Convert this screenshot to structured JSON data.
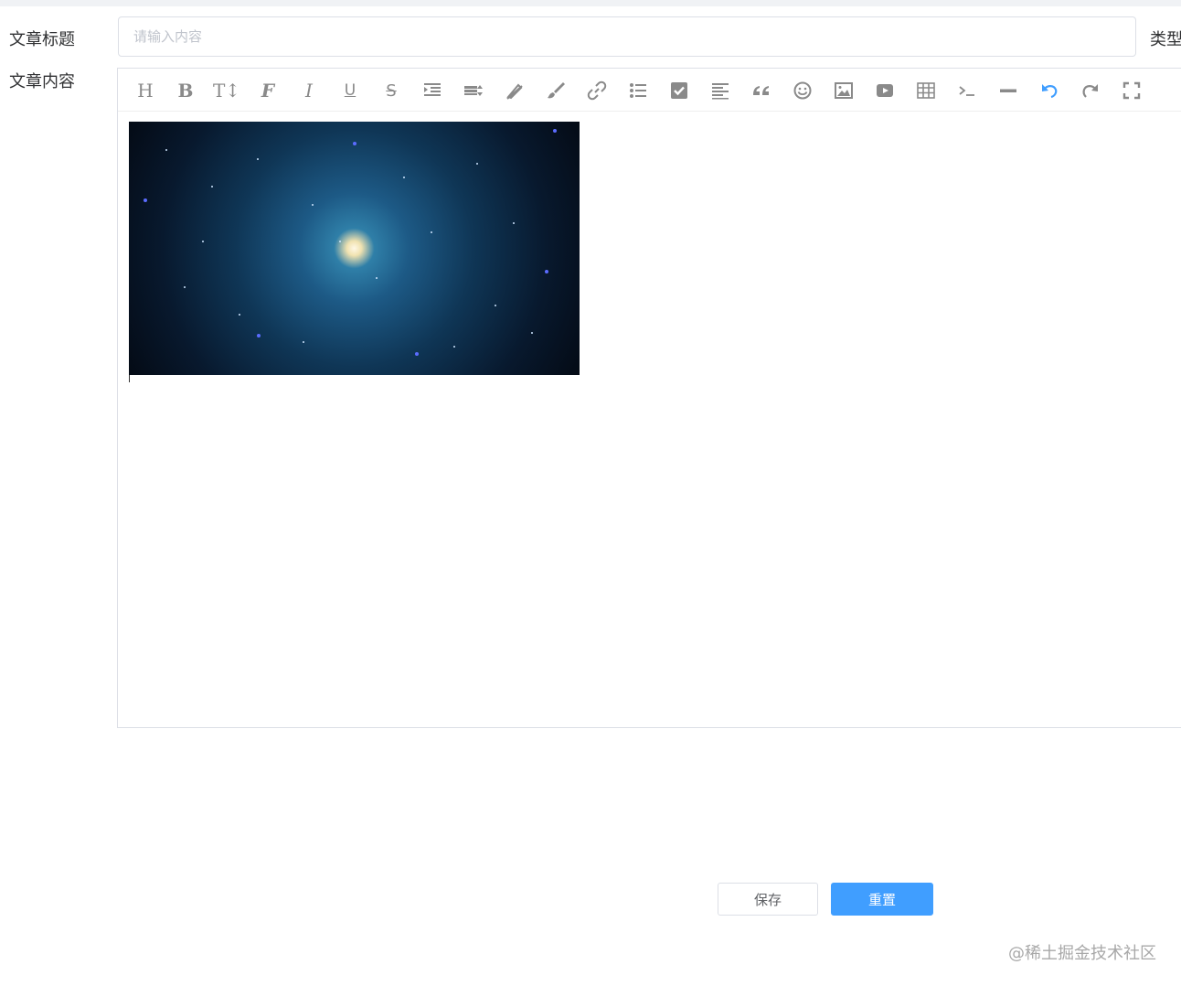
{
  "form": {
    "title_label": "文章标题",
    "title_placeholder": "请输入内容",
    "title_value": "",
    "content_label": "文章内容",
    "type_label": "类型"
  },
  "editor": {
    "toolbar": [
      {
        "name": "heading-icon",
        "glyph": "H"
      },
      {
        "name": "bold-icon",
        "glyph": "B"
      },
      {
        "name": "font-size-icon",
        "glyph": "T↕"
      },
      {
        "name": "font-family-icon",
        "glyph": "F"
      },
      {
        "name": "italic-icon",
        "glyph": "I"
      },
      {
        "name": "underline-icon",
        "glyph": "U"
      },
      {
        "name": "strikethrough-icon",
        "glyph": "S"
      },
      {
        "name": "indent-icon",
        "glyph": ""
      },
      {
        "name": "line-height-icon",
        "glyph": ""
      },
      {
        "name": "font-color-icon",
        "glyph": ""
      },
      {
        "name": "background-color-icon",
        "glyph": ""
      },
      {
        "name": "link-icon",
        "glyph": ""
      },
      {
        "name": "list-icon",
        "glyph": ""
      },
      {
        "name": "checklist-icon",
        "glyph": ""
      },
      {
        "name": "align-icon",
        "glyph": ""
      },
      {
        "name": "quote-icon",
        "glyph": ""
      },
      {
        "name": "emoji-icon",
        "glyph": ""
      },
      {
        "name": "image-icon",
        "glyph": ""
      },
      {
        "name": "video-icon",
        "glyph": ""
      },
      {
        "name": "table-icon",
        "glyph": ""
      },
      {
        "name": "code-icon",
        "glyph": ""
      },
      {
        "name": "divider-icon",
        "glyph": ""
      },
      {
        "name": "undo-icon",
        "glyph": ""
      },
      {
        "name": "redo-icon",
        "glyph": ""
      },
      {
        "name": "fullscreen-icon",
        "glyph": ""
      }
    ],
    "content_image": "galaxy-image"
  },
  "actions": {
    "save_label": "保存",
    "reset_label": "重置"
  },
  "watermark": "@稀土掘金技术社区",
  "colors": {
    "primary": "#409eff",
    "border": "#dcdfe6",
    "icon": "#8a8a8a",
    "undo_active": "#409eff"
  }
}
